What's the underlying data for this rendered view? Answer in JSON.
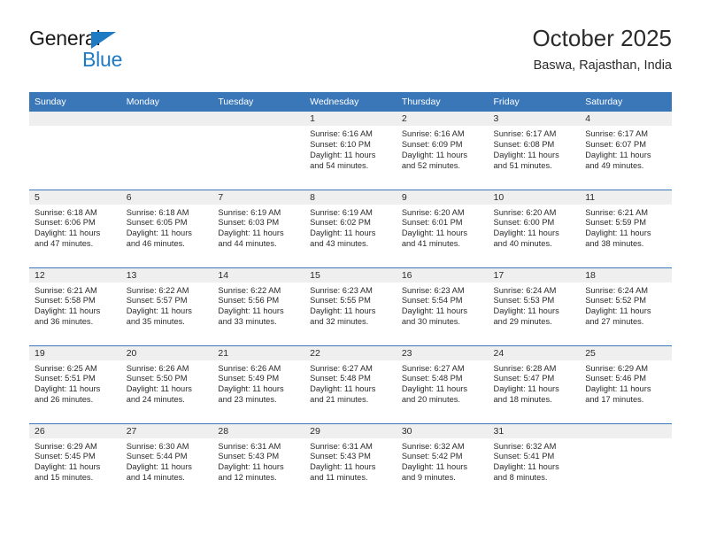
{
  "brand": {
    "name_part1": "General",
    "name_part2": "Blue",
    "triangle_color": "#1f7ac4",
    "blue_text_color": "#1f7ac4"
  },
  "header": {
    "title": "October 2025",
    "subtitle": "Baswa, Rajasthan, India"
  },
  "theme": {
    "header_bar_color": "#3a77b8",
    "daynum_band_color": "#efefef",
    "row_separator_color": "#3a77b8",
    "text_color": "#2b2b2b"
  },
  "columns": [
    "Sunday",
    "Monday",
    "Tuesday",
    "Wednesday",
    "Thursday",
    "Friday",
    "Saturday"
  ],
  "weeks": [
    [
      {
        "day": "",
        "lines": []
      },
      {
        "day": "",
        "lines": []
      },
      {
        "day": "",
        "lines": []
      },
      {
        "day": "1",
        "lines": [
          "Sunrise: 6:16 AM",
          "Sunset: 6:10 PM",
          "Daylight: 11 hours",
          "and 54 minutes."
        ]
      },
      {
        "day": "2",
        "lines": [
          "Sunrise: 6:16 AM",
          "Sunset: 6:09 PM",
          "Daylight: 11 hours",
          "and 52 minutes."
        ]
      },
      {
        "day": "3",
        "lines": [
          "Sunrise: 6:17 AM",
          "Sunset: 6:08 PM",
          "Daylight: 11 hours",
          "and 51 minutes."
        ]
      },
      {
        "day": "4",
        "lines": [
          "Sunrise: 6:17 AM",
          "Sunset: 6:07 PM",
          "Daylight: 11 hours",
          "and 49 minutes."
        ]
      }
    ],
    [
      {
        "day": "5",
        "lines": [
          "Sunrise: 6:18 AM",
          "Sunset: 6:06 PM",
          "Daylight: 11 hours",
          "and 47 minutes."
        ]
      },
      {
        "day": "6",
        "lines": [
          "Sunrise: 6:18 AM",
          "Sunset: 6:05 PM",
          "Daylight: 11 hours",
          "and 46 minutes."
        ]
      },
      {
        "day": "7",
        "lines": [
          "Sunrise: 6:19 AM",
          "Sunset: 6:03 PM",
          "Daylight: 11 hours",
          "and 44 minutes."
        ]
      },
      {
        "day": "8",
        "lines": [
          "Sunrise: 6:19 AM",
          "Sunset: 6:02 PM",
          "Daylight: 11 hours",
          "and 43 minutes."
        ]
      },
      {
        "day": "9",
        "lines": [
          "Sunrise: 6:20 AM",
          "Sunset: 6:01 PM",
          "Daylight: 11 hours",
          "and 41 minutes."
        ]
      },
      {
        "day": "10",
        "lines": [
          "Sunrise: 6:20 AM",
          "Sunset: 6:00 PM",
          "Daylight: 11 hours",
          "and 40 minutes."
        ]
      },
      {
        "day": "11",
        "lines": [
          "Sunrise: 6:21 AM",
          "Sunset: 5:59 PM",
          "Daylight: 11 hours",
          "and 38 minutes."
        ]
      }
    ],
    [
      {
        "day": "12",
        "lines": [
          "Sunrise: 6:21 AM",
          "Sunset: 5:58 PM",
          "Daylight: 11 hours",
          "and 36 minutes."
        ]
      },
      {
        "day": "13",
        "lines": [
          "Sunrise: 6:22 AM",
          "Sunset: 5:57 PM",
          "Daylight: 11 hours",
          "and 35 minutes."
        ]
      },
      {
        "day": "14",
        "lines": [
          "Sunrise: 6:22 AM",
          "Sunset: 5:56 PM",
          "Daylight: 11 hours",
          "and 33 minutes."
        ]
      },
      {
        "day": "15",
        "lines": [
          "Sunrise: 6:23 AM",
          "Sunset: 5:55 PM",
          "Daylight: 11 hours",
          "and 32 minutes."
        ]
      },
      {
        "day": "16",
        "lines": [
          "Sunrise: 6:23 AM",
          "Sunset: 5:54 PM",
          "Daylight: 11 hours",
          "and 30 minutes."
        ]
      },
      {
        "day": "17",
        "lines": [
          "Sunrise: 6:24 AM",
          "Sunset: 5:53 PM",
          "Daylight: 11 hours",
          "and 29 minutes."
        ]
      },
      {
        "day": "18",
        "lines": [
          "Sunrise: 6:24 AM",
          "Sunset: 5:52 PM",
          "Daylight: 11 hours",
          "and 27 minutes."
        ]
      }
    ],
    [
      {
        "day": "19",
        "lines": [
          "Sunrise: 6:25 AM",
          "Sunset: 5:51 PM",
          "Daylight: 11 hours",
          "and 26 minutes."
        ]
      },
      {
        "day": "20",
        "lines": [
          "Sunrise: 6:26 AM",
          "Sunset: 5:50 PM",
          "Daylight: 11 hours",
          "and 24 minutes."
        ]
      },
      {
        "day": "21",
        "lines": [
          "Sunrise: 6:26 AM",
          "Sunset: 5:49 PM",
          "Daylight: 11 hours",
          "and 23 minutes."
        ]
      },
      {
        "day": "22",
        "lines": [
          "Sunrise: 6:27 AM",
          "Sunset: 5:48 PM",
          "Daylight: 11 hours",
          "and 21 minutes."
        ]
      },
      {
        "day": "23",
        "lines": [
          "Sunrise: 6:27 AM",
          "Sunset: 5:48 PM",
          "Daylight: 11 hours",
          "and 20 minutes."
        ]
      },
      {
        "day": "24",
        "lines": [
          "Sunrise: 6:28 AM",
          "Sunset: 5:47 PM",
          "Daylight: 11 hours",
          "and 18 minutes."
        ]
      },
      {
        "day": "25",
        "lines": [
          "Sunrise: 6:29 AM",
          "Sunset: 5:46 PM",
          "Daylight: 11 hours",
          "and 17 minutes."
        ]
      }
    ],
    [
      {
        "day": "26",
        "lines": [
          "Sunrise: 6:29 AM",
          "Sunset: 5:45 PM",
          "Daylight: 11 hours",
          "and 15 minutes."
        ]
      },
      {
        "day": "27",
        "lines": [
          "Sunrise: 6:30 AM",
          "Sunset: 5:44 PM",
          "Daylight: 11 hours",
          "and 14 minutes."
        ]
      },
      {
        "day": "28",
        "lines": [
          "Sunrise: 6:31 AM",
          "Sunset: 5:43 PM",
          "Daylight: 11 hours",
          "and 12 minutes."
        ]
      },
      {
        "day": "29",
        "lines": [
          "Sunrise: 6:31 AM",
          "Sunset: 5:43 PM",
          "Daylight: 11 hours",
          "and 11 minutes."
        ]
      },
      {
        "day": "30",
        "lines": [
          "Sunrise: 6:32 AM",
          "Sunset: 5:42 PM",
          "Daylight: 11 hours",
          "and 9 minutes."
        ]
      },
      {
        "day": "31",
        "lines": [
          "Sunrise: 6:32 AM",
          "Sunset: 5:41 PM",
          "Daylight: 11 hours",
          "and 8 minutes."
        ]
      },
      {
        "day": "",
        "lines": []
      }
    ]
  ]
}
